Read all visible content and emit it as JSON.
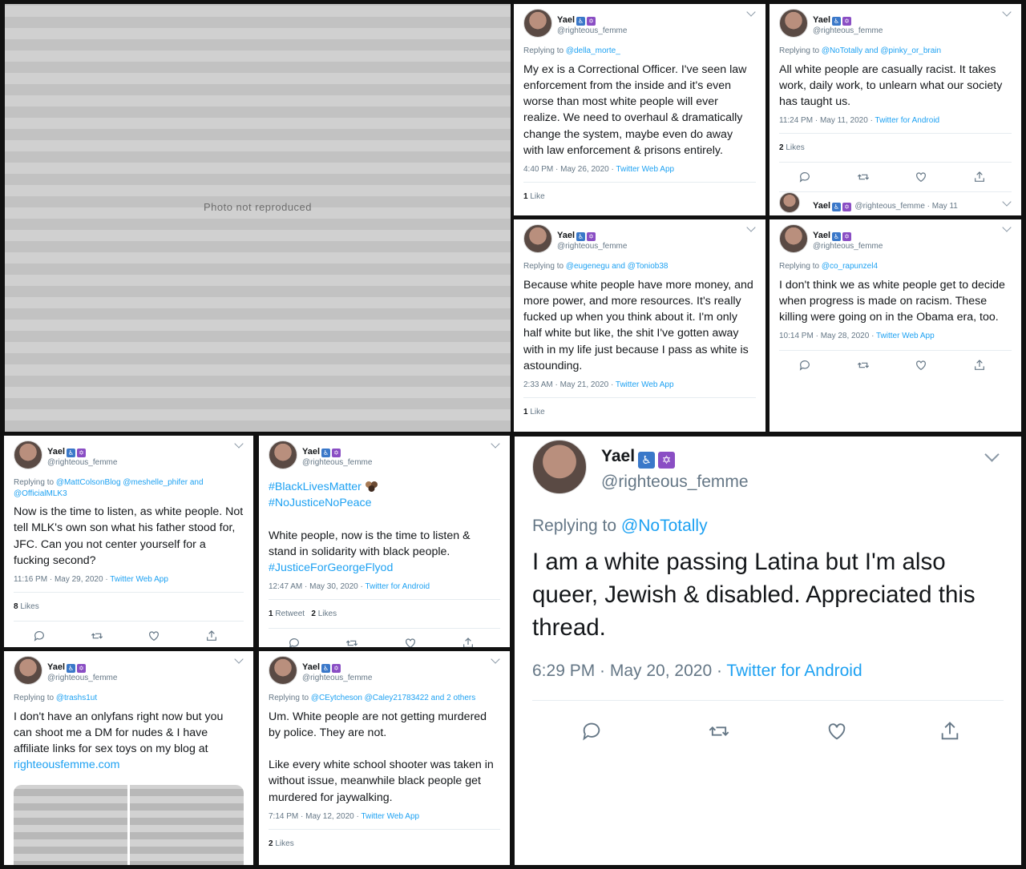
{
  "user": {
    "display_name": "Yael",
    "handle": "@righteous_femme",
    "badges": [
      "wheelchair-icon",
      "star-of-david-icon"
    ]
  },
  "photo": {
    "note": "Photo not reproduced"
  },
  "colors": {
    "link": "#1da1f2",
    "muted": "#657786",
    "border": "#e6ecf0",
    "text": "#14171a"
  },
  "tweets": [
    {
      "replying_label": "Replying to",
      "replying_to": "@della_morte_",
      "text": "My ex is a Correctional Officer. I've seen law enforcement from the inside and it's even worse than most white people will ever realize. We need to overhaul & dramatically change the  system, maybe even do away with law enforcement & prisons entirely.",
      "time": "4:40 PM · May 26, 2020 · ",
      "source": "Twitter Web App",
      "stat_count": "1",
      "stat_label": "Like"
    },
    {
      "replying_label": "Replying to",
      "replying_to": "@NoTotally and @pinky_or_brain",
      "text": "All white people are casually racist. It takes work, daily work, to unlearn what our society has taught us.",
      "time": "11:24 PM · May 11, 2020 · ",
      "source": "Twitter for Android",
      "stat_count": "2",
      "stat_label": "Likes",
      "next_header": "@righteous_femme · May 11"
    },
    {
      "replying_label": "Replying to",
      "replying_to": "@eugenegu and @Toniob38",
      "text": "Because white people have more money, and more power, and more resources. It's really fucked up when you think about it. I'm only half white but like, the shit I've gotten away with in my life just because I pass as white is astounding.",
      "time": "2:33 AM · May 21, 2020 · ",
      "source": "Twitter Web App",
      "stat_count": "1",
      "stat_label": "Like"
    },
    {
      "replying_label": "Replying to",
      "replying_to": "@co_rapunzel4",
      "text": "I don't think we as white people get to decide when progress is made on racism. These killing were going on in the Obama era, too.",
      "time": "10:14 PM · May 28, 2020 · ",
      "source": "Twitter Web App"
    },
    {
      "replying_label": "Replying to",
      "replying_to": "@MattColsonBlog @meshelle_phifer and @OfficialMLK3",
      "text": "Now is the time to listen, as white people. Not tell MLK's own son what his father stood for, JFC. Can you not center yourself for a fucking second?",
      "time": "11:16 PM · May 29, 2020 · ",
      "source": "Twitter Web App",
      "stat_count": "8",
      "stat_label": "Likes"
    },
    {
      "hashtag1": "#BlackLivesMatter",
      "hashtag2": "#NoJusticeNoPeace",
      "text": "White people, now is the time to listen & stand in solidarity with black people.",
      "hashtag3": "#JusticeForGeorgeFlyod",
      "time": "12:47 AM · May 30, 2020 · ",
      "source": "Twitter for Android",
      "retweet_count": "1",
      "retweet_label": "Retweet",
      "stat_count": "2",
      "stat_label": "Likes"
    },
    {
      "replying_label": "Replying to",
      "replying_to": "@trashs1ut",
      "text": "I don't have an onlyfans right now but you can shoot me a DM for nudes & I have affiliate links for sex toys on my blog at",
      "link": "righteousfemme.com"
    },
    {
      "replying_label": "Replying to",
      "replying_to": "@CEytcheson @Caley21783422 and 2 others",
      "text_p1": "Um. White people are not getting murdered by police. They are not.",
      "text_p2": "Like every white school shooter was taken in without issue, meanwhile black people get murdered for jaywalking.",
      "time": "7:14 PM · May 12, 2020 · ",
      "source": "Twitter Web App",
      "stat_count": "2",
      "stat_label": "Likes"
    }
  ],
  "featured": {
    "replying_label": "Replying to",
    "replying_to": "@NoTotally",
    "text": "I am a white passing Latina but I'm also queer, Jewish & disabled. Appreciated this thread.",
    "time": "6:29 PM · May 20, 2020 · ",
    "source": "Twitter for Android"
  }
}
